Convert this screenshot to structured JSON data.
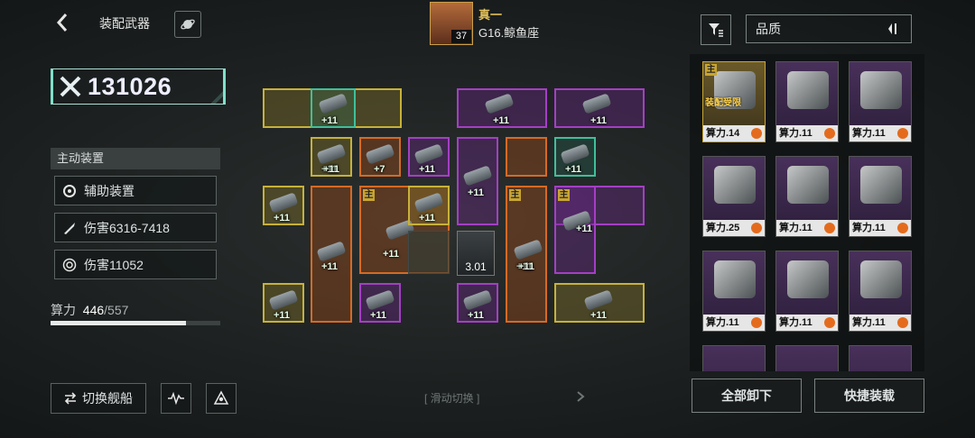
{
  "header": {
    "title": "装配武器"
  },
  "captain": {
    "name": "真一",
    "ship": "G16.鲸鱼座",
    "level": "37"
  },
  "power": {
    "value": "131026"
  },
  "left_panel": {
    "section": "主动装置",
    "stats": [
      "辅助装置",
      "伤害6316-7418",
      "伤害11052"
    ],
    "compute_label": "算力",
    "compute_current": "446",
    "compute_max": "/557",
    "compute_ratio": 0.8
  },
  "bottom": {
    "switch_ship": "切换舰船",
    "swipe_hint": "滑动切换",
    "unequip_all": "全部卸下",
    "quick_equip": "快捷装载"
  },
  "filter": {
    "sort_label": "品质"
  },
  "grid": {
    "main_tag": "主",
    "display_value": "3.01",
    "levels": [
      "+11",
      "+11",
      "+11",
      "+11",
      "+7",
      "+11",
      "+11",
      "+11",
      "+11",
      "+11",
      "+11",
      "+11",
      "+11",
      "+11",
      "+11",
      "+11",
      "+11",
      "+11",
      "+11",
      "+11"
    ]
  },
  "inventory": {
    "main_tag": "主",
    "warning": "装配受限",
    "cards": [
      "算力.14",
      "算力.11",
      "算力.11",
      "算力.25",
      "算力.11",
      "算力.11",
      "算力.11",
      "算力.11",
      "算力.11"
    ]
  },
  "colors": {
    "rarity_gold": "#c7b13a",
    "rarity_purple": "#a43fc4",
    "rarity_orange": "#d66a24",
    "accent_teal": "#7fe0c9"
  }
}
